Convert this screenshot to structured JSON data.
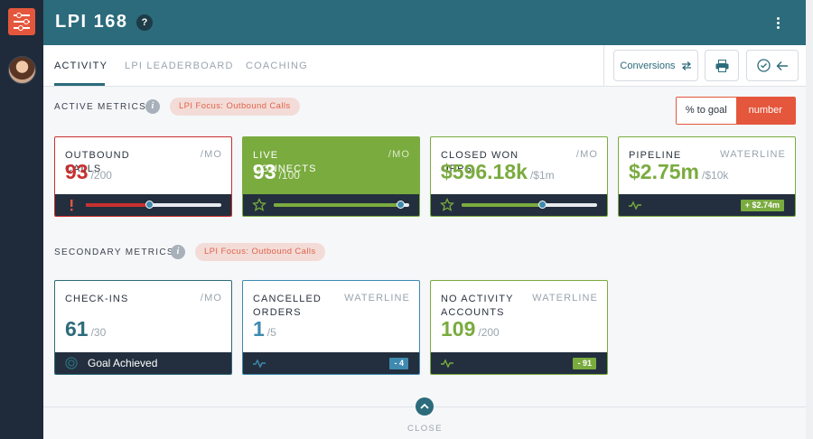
{
  "header": {
    "title": "LPI 168",
    "help_label": "?"
  },
  "tabs": [
    {
      "label": "ACTIVITY",
      "active": true
    },
    {
      "label": "LPI LEADERBOARD",
      "active": false
    },
    {
      "label": "COACHING",
      "active": false
    }
  ],
  "toolbar": {
    "conversions_label": "Conversions"
  },
  "active_section": {
    "label": "ACTIVE METRICS",
    "focus_pill": "LPI Focus: Outbound Calls",
    "toggle": {
      "percent_label": "% to goal",
      "number_label": "number",
      "selected": "number"
    },
    "cards": [
      {
        "name": "OUTBOUND CALLS",
        "period": "/MO",
        "value": "93",
        "goal": "/200",
        "progress": 0.465,
        "status": "alert"
      },
      {
        "name": "LIVE CONNECTS",
        "period": "/MO",
        "value": "93",
        "goal": "/100",
        "progress": 0.93,
        "status": "star"
      },
      {
        "name": "CLOSED WON OPPS",
        "period": "/MO",
        "value": "$596.18k",
        "goal": "/$1m",
        "progress": 0.596,
        "status": "star"
      },
      {
        "name": "PIPELINE",
        "period": "WATERLINE",
        "value": "$2.75m",
        "goal": "/$10k",
        "badge": "+ $2.74m",
        "status": "pulse"
      }
    ]
  },
  "secondary_section": {
    "label": "SECONDARY METRICS",
    "focus_pill": "LPI Focus: Outbound Calls",
    "cards": [
      {
        "name": "CHECK-INS",
        "period": "/MO",
        "value": "61",
        "goal": "/30",
        "footer_text": "Goal Achieved"
      },
      {
        "name": "CANCELLED ORDERS",
        "period": "WATERLINE",
        "value": "1",
        "goal": "/5",
        "badge": "- 4"
      },
      {
        "name": "NO ACTIVITY ACCOUNTS",
        "period": "WATERLINE",
        "value": "109",
        "goal": "/200",
        "badge": "- 91"
      }
    ]
  },
  "footer": {
    "close_label": "CLOSE"
  },
  "colors": {
    "header": "#2c6b7b",
    "accent": "#e4573d",
    "danger": "#c8302f",
    "success": "#7aab3f",
    "info": "#2c6b7b",
    "dark": "#232f3e"
  }
}
